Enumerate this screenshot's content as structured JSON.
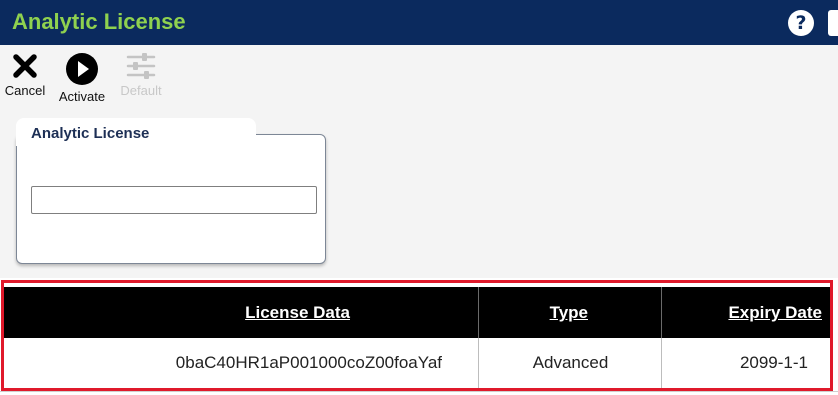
{
  "window": {
    "title": "Analytic License",
    "help_glyph": "?"
  },
  "toolbar": {
    "cancel_label": "Cancel",
    "activate_label": "Activate",
    "default_label": "Default"
  },
  "panel": {
    "title": "Analytic License",
    "input_value": ""
  },
  "table": {
    "headers": [
      "License Data",
      "Type",
      "Expiry Date"
    ],
    "rows": [
      [
        "0baC40HR1aP001000coZ00foaYaf",
        "Advanced",
        "2099-1-1"
      ]
    ]
  },
  "colors": {
    "titlebar": "#0b2a5e",
    "title_text": "#8fd14f",
    "highlight": "#e0192b"
  }
}
